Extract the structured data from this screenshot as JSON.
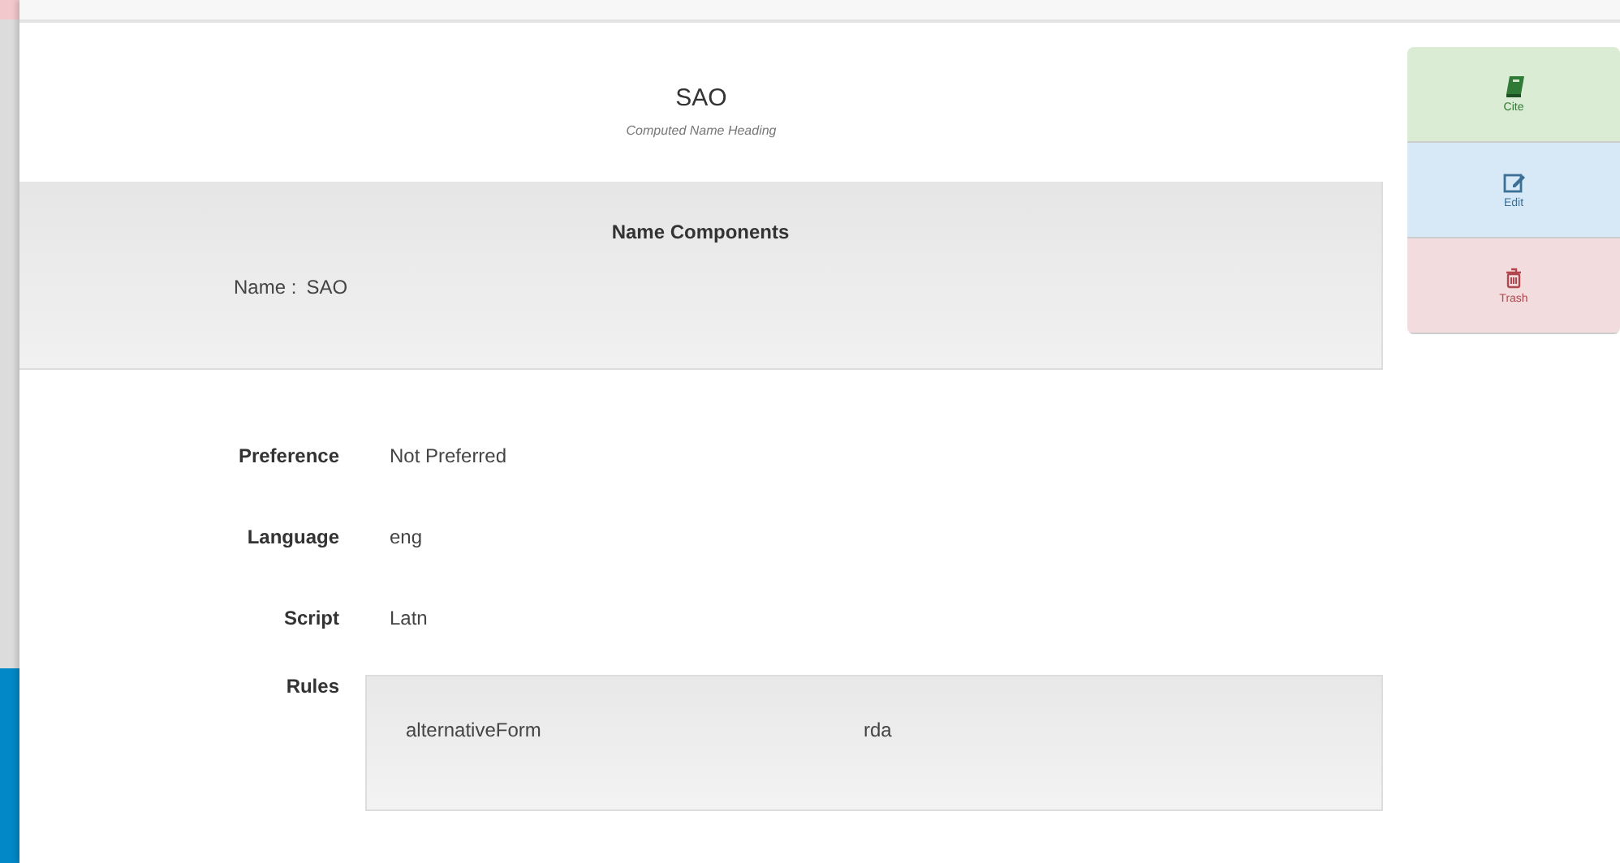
{
  "heading": {
    "title": "SAO",
    "subtitle": "Computed Name Heading"
  },
  "name_components": {
    "title": "Name Components",
    "items": [
      {
        "label": "Name :",
        "value": "SAO"
      }
    ]
  },
  "fields": [
    {
      "label": "Preference",
      "value": "Not Preferred"
    },
    {
      "label": "Language",
      "value": "eng"
    },
    {
      "label": "Script",
      "value": "Latn"
    }
  ],
  "rules": {
    "label": "Rules",
    "items": [
      {
        "rule": "alternativeForm",
        "source": "rda"
      }
    ]
  },
  "actions": [
    {
      "kind": "cite",
      "label": "Cite"
    },
    {
      "kind": "edit",
      "label": "Edit"
    },
    {
      "kind": "trash",
      "label": "Trash"
    }
  ]
}
